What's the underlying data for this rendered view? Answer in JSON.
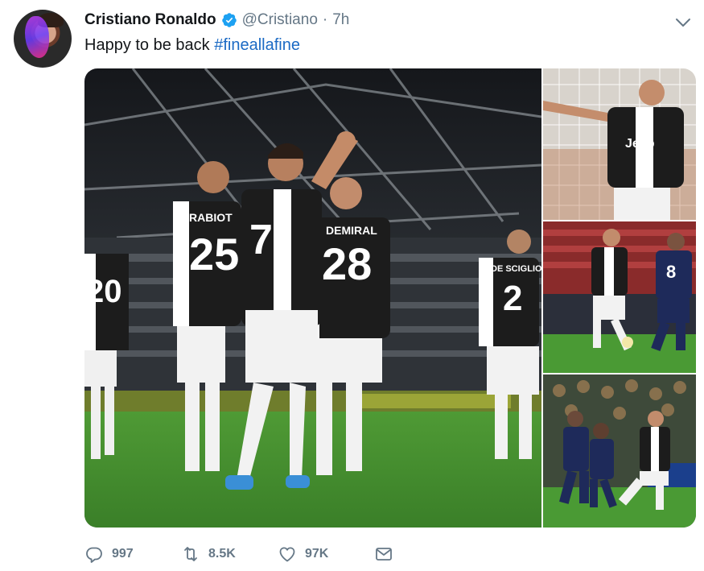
{
  "tweet": {
    "author_name": "Cristiano Ronaldo",
    "handle": "@Cristiano",
    "separator": "·",
    "time": "7h",
    "text_prefix": "Happy to be back ",
    "hashtag": "#fineallafine",
    "actions": {
      "replies": "997",
      "retweets": "8.5K",
      "likes": "97K"
    },
    "jerseys": {
      "player1_name": "RABIOT",
      "player1_number": "25",
      "player2_number": "7",
      "player3_name": "DEMIRAL",
      "player3_number": "28",
      "player4_name": "DE SCIGLIO",
      "player4_number": "2",
      "player5_number": "20",
      "opponent_number": "8",
      "sponsor": "Jeep"
    }
  },
  "colors": {
    "accent": "#1b6ac4",
    "verified": "#1da1f2",
    "muted": "#657786",
    "pitch": "#3f8b2c",
    "stadium": "#1e2126"
  },
  "icons": [
    "verified-badge-icon",
    "chevron-down-icon",
    "reply-icon",
    "retweet-icon",
    "like-icon",
    "direct-message-icon"
  ]
}
